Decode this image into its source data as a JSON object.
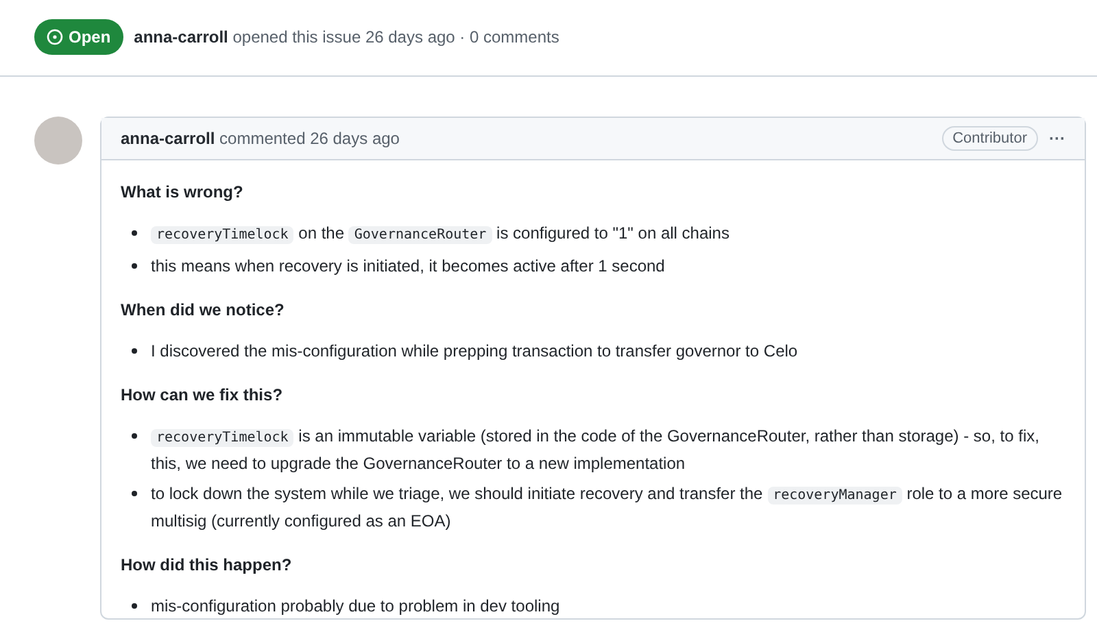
{
  "issue": {
    "state": {
      "kind": "open",
      "label": "Open"
    },
    "author": "anna-carroll",
    "meta": "opened this issue 26 days ago · 0 comments"
  },
  "comment": {
    "author": "anna-carroll",
    "time": "commented 26 days ago",
    "badge": "Contributor",
    "menu": "···",
    "sections": [
      {
        "heading": "What is wrong?",
        "bullets": [
          {
            "parts": [
              {
                "kind": "code",
                "text": "recoveryTimelock"
              },
              {
                "kind": "text",
                "text": " on the "
              },
              {
                "kind": "code",
                "text": "GovernanceRouter"
              },
              {
                "kind": "text",
                "text": " is configured to \"1\" on all chains"
              }
            ]
          },
          {
            "parts": [
              {
                "kind": "text",
                "text": "this means when recovery is initiated, it becomes active after 1 second"
              }
            ]
          }
        ]
      },
      {
        "heading": "When did we notice?",
        "bullets": [
          {
            "parts": [
              {
                "kind": "text",
                "text": "I discovered the mis-configuration while prepping transaction to transfer governor to Celo"
              }
            ]
          }
        ]
      },
      {
        "heading": "How can we fix this?",
        "bullets": [
          {
            "parts": [
              {
                "kind": "code",
                "text": "recoveryTimelock"
              },
              {
                "kind": "text",
                "text": " is an immutable variable (stored in the code of the GovernanceRouter, rather than storage) - so, to fix, this, we need to upgrade the GovernanceRouter to a new implementation"
              }
            ]
          },
          {
            "parts": [
              {
                "kind": "text",
                "text": "to lock down the system while we triage, we should initiate recovery and transfer the "
              },
              {
                "kind": "code",
                "text": "recoveryManager"
              },
              {
                "kind": "text",
                "text": " role to a more secure multisig (currently configured as an EOA)"
              }
            ]
          }
        ]
      },
      {
        "heading": "How did this happen?",
        "bullets": [
          {
            "parts": [
              {
                "kind": "text",
                "text": "mis-configuration probably due to problem in dev tooling"
              }
            ]
          }
        ]
      }
    ]
  }
}
